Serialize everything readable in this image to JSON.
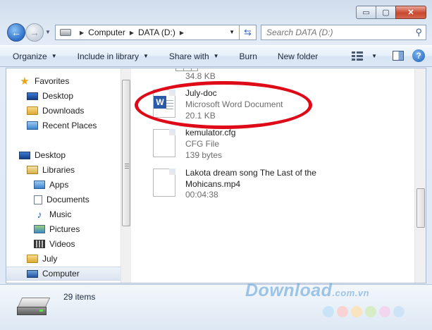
{
  "window": {
    "caption_buttons": {
      "minimize": "▭",
      "maximize": "▢",
      "close": "✕"
    }
  },
  "nav": {
    "back_icon": "back-arrow-icon",
    "forward_icon": "forward-arrow-icon",
    "breadcrumbs": [
      "Computer",
      "DATA (D:)"
    ],
    "search_placeholder": "Search DATA (D:)"
  },
  "toolbar": {
    "organize": "Organize",
    "include_in_library": "Include in library",
    "share_with": "Share with",
    "burn": "Burn",
    "new_folder": "New folder"
  },
  "sidebar": {
    "items": [
      {
        "label": "Favorites",
        "icon": "star-icon"
      },
      {
        "label": "Desktop",
        "icon": "desktop-icon"
      },
      {
        "label": "Downloads",
        "icon": "downloads-folder-icon"
      },
      {
        "label": "Recent Places",
        "icon": "recent-places-icon"
      },
      {
        "label": "Desktop",
        "icon": "desktop-icon"
      },
      {
        "label": "Libraries",
        "icon": "libraries-icon"
      },
      {
        "label": "Apps",
        "icon": "library-folder-icon"
      },
      {
        "label": "Documents",
        "icon": "documents-icon"
      },
      {
        "label": "Music",
        "icon": "music-icon"
      },
      {
        "label": "Pictures",
        "icon": "pictures-icon"
      },
      {
        "label": "Videos",
        "icon": "videos-icon"
      },
      {
        "label": "July",
        "icon": "user-folder-icon"
      },
      {
        "label": "Computer",
        "icon": "computer-icon",
        "selected": true
      }
    ]
  },
  "files": [
    {
      "name": "",
      "type": "",
      "size": "34.8 KB",
      "icon": "spreadsheet-icon"
    },
    {
      "name": "July-doc",
      "type": "Microsoft Word Document",
      "size": "20.1 KB",
      "icon": "word-document-icon"
    },
    {
      "name": "kemulator.cfg",
      "type": "CFG File",
      "size": "139 bytes",
      "icon": "generic-file-icon"
    },
    {
      "name": "Lakota dream song The Last of the Mohicans.mp4",
      "type": "",
      "size": "00:04:38",
      "icon": "video-file-icon"
    }
  ],
  "details": {
    "item_count": "29 items"
  },
  "watermark": {
    "text": "Download",
    "suffix": ".com.vn"
  },
  "colors": {
    "highlight_ring": "#de0a18",
    "dots": [
      "#c9e3f7",
      "#f9d2d2",
      "#fae3bf",
      "#d6edc6",
      "#f2d6ef",
      "#cfe3f7"
    ]
  }
}
